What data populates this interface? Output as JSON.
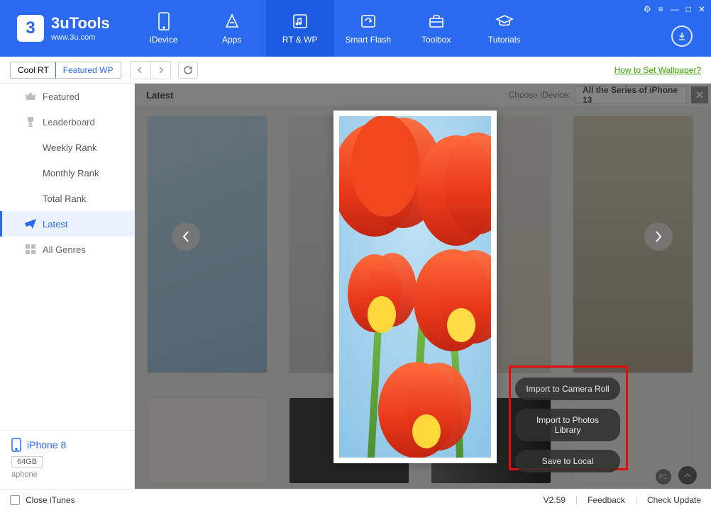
{
  "app": {
    "title": "3uTools",
    "site": "www.3u.com"
  },
  "nav": {
    "items": [
      {
        "label": "iDevice"
      },
      {
        "label": "Apps"
      },
      {
        "label": "RT & WP"
      },
      {
        "label": "Smart Flash"
      },
      {
        "label": "Toolbox"
      },
      {
        "label": "Tutorials"
      }
    ]
  },
  "subbar": {
    "coolrt": "Cool RT",
    "featuredwp": "Featured WP",
    "help": "How to Set Wallpaper?"
  },
  "sidebar": {
    "featured": "Featured",
    "leaderboard": "Leaderboard",
    "weekly": "Weekly Rank",
    "monthly": "Monthly Rank",
    "total": "Total Rank",
    "latest": "Latest",
    "allgenres": "All Genres"
  },
  "device": {
    "name": "iPhone 8",
    "storage": "64GB",
    "label": "aphone"
  },
  "main": {
    "section": "Latest",
    "choose_label": "Choose iDevice:",
    "filter": "All the Series of iPhone 13"
  },
  "context_menu": {
    "camera_roll": "Import to Camera Roll",
    "photos_library": "Import to Photos Library",
    "save_local": "Save to Local"
  },
  "badges": {
    "p1": "P1"
  },
  "footer": {
    "close_itunes": "Close iTunes",
    "version": "V2.59",
    "feedback": "Feedback",
    "check_update": "Check Update"
  }
}
